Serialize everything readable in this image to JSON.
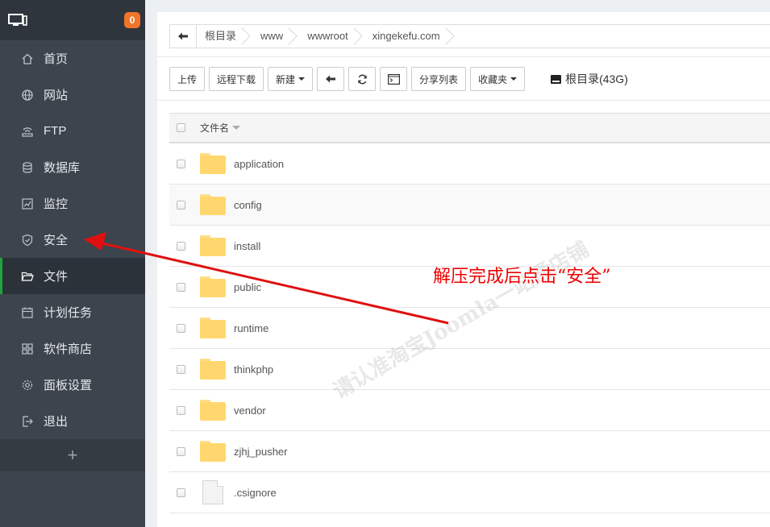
{
  "sidebar": {
    "badge": "0",
    "items": [
      {
        "label": "首页",
        "icon": "home-icon"
      },
      {
        "label": "网站",
        "icon": "globe-icon"
      },
      {
        "label": "FTP",
        "icon": "ftp-icon"
      },
      {
        "label": "数据库",
        "icon": "database-icon"
      },
      {
        "label": "监控",
        "icon": "monitor-chart-icon"
      },
      {
        "label": "安全",
        "icon": "shield-icon"
      },
      {
        "label": "文件",
        "icon": "folder-open-icon",
        "active": true
      },
      {
        "label": "计划任务",
        "icon": "calendar-icon"
      },
      {
        "label": "软件商店",
        "icon": "apps-grid-icon"
      },
      {
        "label": "面板设置",
        "icon": "gear-icon"
      },
      {
        "label": "退出",
        "icon": "logout-icon"
      }
    ],
    "add": "+"
  },
  "breadcrumb": [
    "根目录",
    "www",
    "wwwroot",
    "xingekefu.com"
  ],
  "toolbar": {
    "upload": "上传",
    "remote_download": "远程下载",
    "new": "新建",
    "share_list": "分享列表",
    "favorites": "收藏夹",
    "disk": "根目录(43G)"
  },
  "table": {
    "header": "文件名",
    "rows": [
      {
        "name": "application",
        "type": "folder"
      },
      {
        "name": "config",
        "type": "folder"
      },
      {
        "name": "install",
        "type": "folder"
      },
      {
        "name": "public",
        "type": "folder"
      },
      {
        "name": "runtime",
        "type": "folder"
      },
      {
        "name": "thinkphp",
        "type": "folder"
      },
      {
        "name": "vendor",
        "type": "folder"
      },
      {
        "name": "zjhj_pusher",
        "type": "folder"
      },
      {
        "name": ".csignore",
        "type": "file"
      }
    ]
  },
  "annotation": "解压完成后点击“安全”",
  "watermark": "请认准淘宝Joomla一站通店铺",
  "colors": {
    "accent": "#20a53a",
    "badge": "#f0742a",
    "annotation": "#e00000",
    "sidebar": "#3c444d"
  }
}
